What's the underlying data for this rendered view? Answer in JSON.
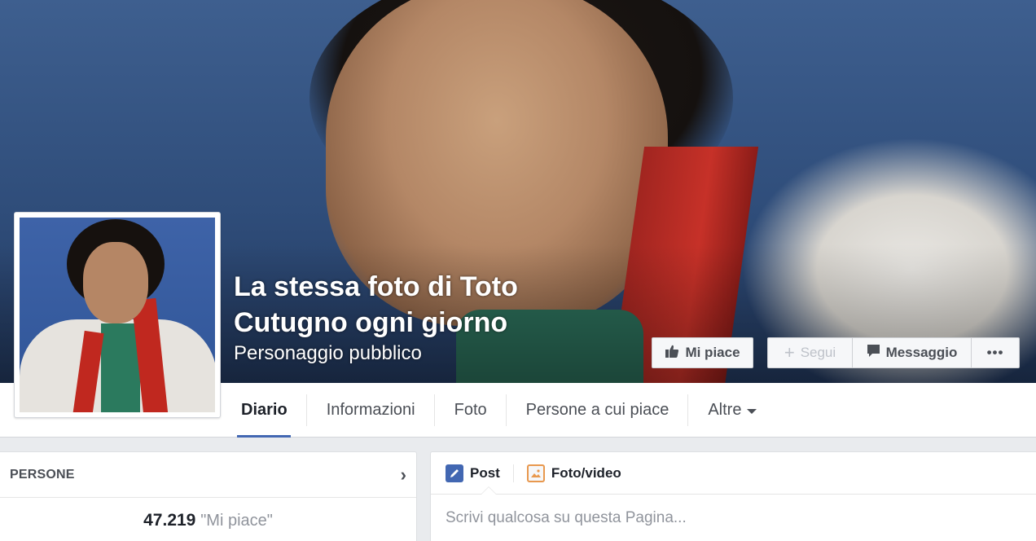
{
  "page": {
    "name": "La stessa foto di Toto Cutugno ogni giorno",
    "category": "Personaggio pubblico"
  },
  "actions": {
    "like": "Mi piace",
    "follow": "Segui",
    "message": "Messaggio",
    "more": "•••"
  },
  "nav": {
    "tabs": [
      {
        "label": "Diario",
        "active": true
      },
      {
        "label": "Informazioni"
      },
      {
        "label": "Foto"
      },
      {
        "label": "Persone a cui piace"
      },
      {
        "label": "Altre"
      }
    ]
  },
  "people": {
    "title": "PERSONE",
    "likes_count": "47.219",
    "likes_label": "\"Mi piace\""
  },
  "composer": {
    "tab_post": "Post",
    "tab_photo": "Foto/video",
    "placeholder": "Scrivi qualcosa su questa Pagina..."
  },
  "colors": {
    "accent": "#4267b2",
    "page_bg": "#e9ebee"
  }
}
